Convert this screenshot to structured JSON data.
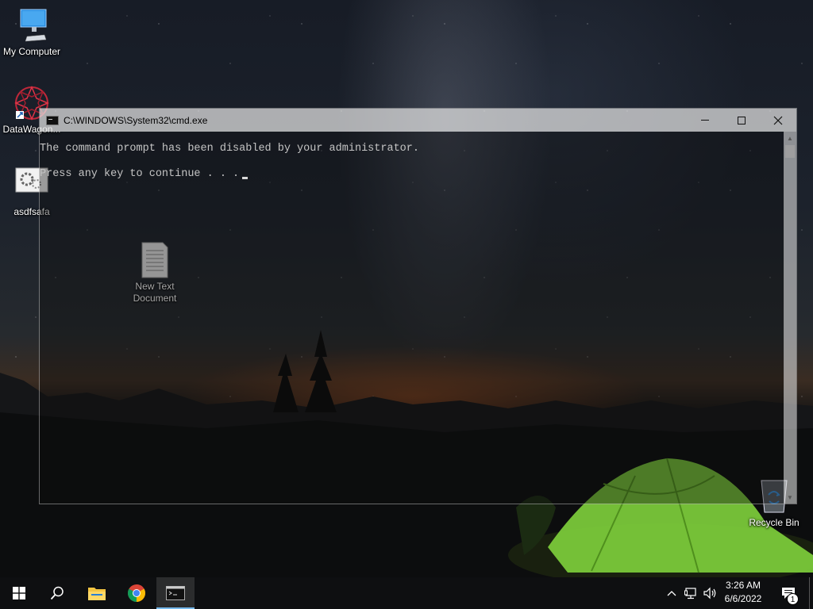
{
  "desktop": {
    "icons": [
      {
        "label": "My Computer",
        "icon": "monitor-icon"
      },
      {
        "label": "DataWagon...",
        "icon": "datawagon-icon"
      },
      {
        "label": "asdfsafa",
        "icon": "settings-file-icon"
      },
      {
        "label": "New Text Document",
        "label_line1": "New Text",
        "label_line2": "Document",
        "icon": "text-document-icon"
      },
      {
        "label": "Recycle Bin",
        "icon": "recycle-bin-icon"
      }
    ]
  },
  "cmd_window": {
    "title": "C:\\WINDOWS\\System32\\cmd.exe",
    "lines": [
      "The command prompt has been disabled by your administrator.",
      "Press any key to continue . . ."
    ],
    "controls": {
      "minimize": "minimize-icon",
      "maximize": "maximize-icon",
      "close": "close-icon"
    }
  },
  "taskbar": {
    "apps": [
      {
        "name": "start",
        "icon": "windows-logo-icon"
      },
      {
        "name": "search",
        "icon": "search-icon"
      },
      {
        "name": "file-explorer",
        "icon": "folder-icon"
      },
      {
        "name": "chrome",
        "icon": "chrome-icon"
      },
      {
        "name": "command-prompt",
        "icon": "terminal-icon",
        "active": true
      }
    ],
    "tray": {
      "icons": [
        "chevron-up-icon",
        "network-icon",
        "volume-icon"
      ],
      "time": "3:26 AM",
      "date": "6/6/2022",
      "notification_count": "1"
    }
  },
  "colors": {
    "taskbar_bg": "#0e0f11",
    "active_indicator": "#76b9ed",
    "console_text": "#c4c4c4",
    "tent_green": "#7fd23c"
  }
}
